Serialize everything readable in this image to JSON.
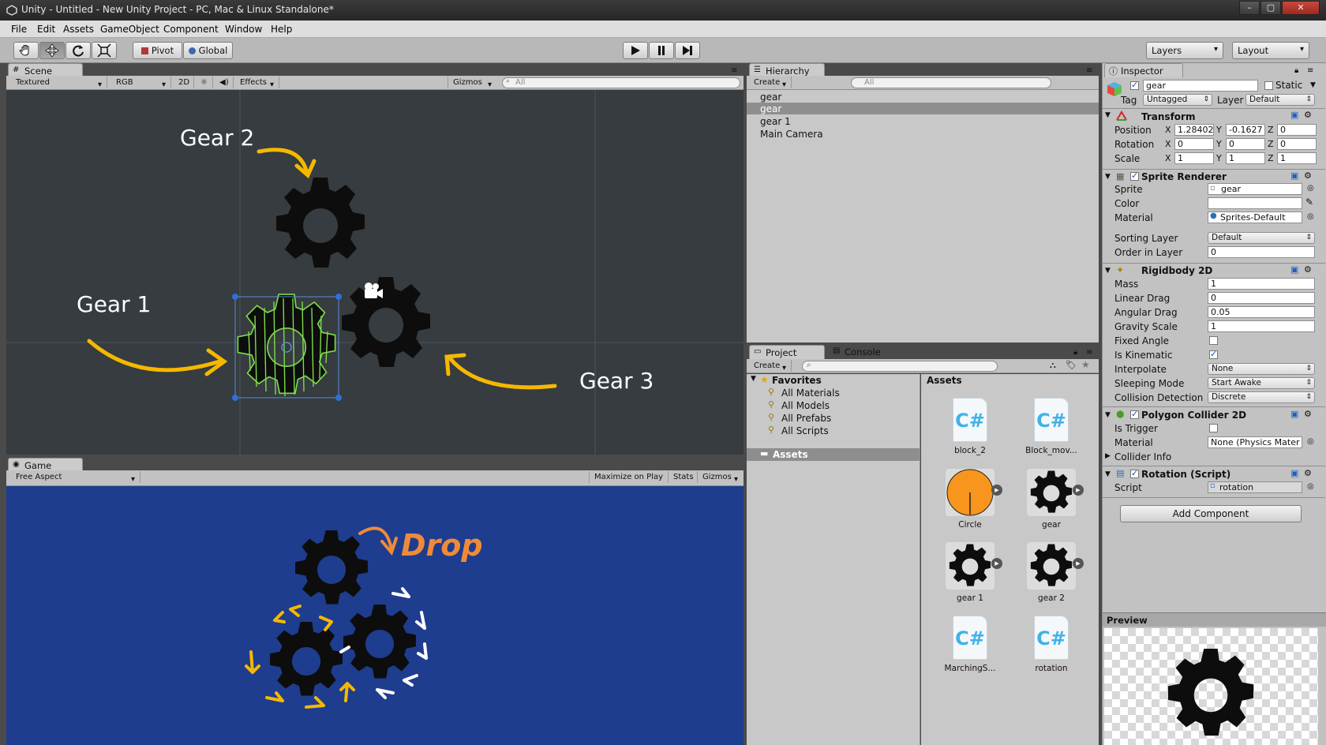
{
  "window": {
    "title": "Unity - Untitled - New Unity Project - PC, Mac & Linux Standalone*",
    "controls": [
      "–",
      "▢",
      "✕"
    ]
  },
  "menu": [
    "File",
    "Edit",
    "Assets",
    "GameObject",
    "Component",
    "Window",
    "Help"
  ],
  "toolbar": {
    "pivot": "Pivot",
    "global": "Global",
    "layers": "Layers",
    "layout": "Layout",
    "tools": [
      "hand-icon",
      "move-icon",
      "rotate-icon",
      "scale-icon"
    ],
    "transport": [
      "play-icon",
      "pause-icon",
      "step-icon"
    ]
  },
  "scene": {
    "tab": "Scene",
    "shading": "Textured",
    "render_mode": "RGB",
    "mode_2d": "2D",
    "effects": "Effects",
    "gizmos": "Gizmos",
    "search_placeholder": "All",
    "annotations": {
      "gear1": "Gear 1",
      "gear2": "Gear 2",
      "gear3": "Gear 3"
    }
  },
  "game": {
    "tab": "Game",
    "aspect": "Free Aspect",
    "maximize": "Maximize on Play",
    "stats": "Stats",
    "gizmos": "Gizmos",
    "drop_label": "Drop"
  },
  "hierarchy": {
    "tab": "Hierarchy",
    "create": "Create",
    "search_placeholder": "All",
    "items": [
      "gear",
      "gear",
      "gear 1",
      "Main Camera"
    ],
    "selected_index": 1
  },
  "project": {
    "tab": "Project",
    "console_tab": "Console",
    "create": "Create",
    "favorites_label": "Favorites",
    "favorites": [
      "All Materials",
      "All Models",
      "All Prefabs",
      "All Scripts"
    ],
    "assets_folder": "Assets",
    "assets_header": "Assets",
    "assets": [
      {
        "name": "block_2",
        "kind": "script"
      },
      {
        "name": "Block_mov...",
        "kind": "script"
      },
      {
        "name": "Circle",
        "kind": "circle"
      },
      {
        "name": "gear",
        "kind": "gear"
      },
      {
        "name": "gear 1",
        "kind": "gear"
      },
      {
        "name": "gear 2",
        "kind": "gear"
      },
      {
        "name": "MarchingS...",
        "kind": "script"
      },
      {
        "name": "rotation",
        "kind": "script"
      }
    ]
  },
  "inspector": {
    "tab": "Inspector",
    "object_name": "gear",
    "static_label": "Static",
    "tag_label": "Tag",
    "tag": "Untagged",
    "layer_label": "Layer",
    "layer": "Default",
    "transform": {
      "title": "Transform",
      "position_label": "Position",
      "rotation_label": "Rotation",
      "scale_label": "Scale",
      "position": [
        "1.28402",
        "-0.1627",
        "0"
      ],
      "rotation": [
        "0",
        "0",
        "0"
      ],
      "scale": [
        "1",
        "1",
        "1"
      ]
    },
    "axes": [
      "X",
      "Y",
      "Z"
    ],
    "sprite_renderer": {
      "title": "Sprite Renderer",
      "sprite_label": "Sprite",
      "sprite": "gear",
      "color_label": "Color",
      "material_label": "Material",
      "material": "Sprites-Default",
      "sorting_layer_label": "Sorting Layer",
      "sorting_layer": "Default",
      "order_label": "Order in Layer",
      "order": "0"
    },
    "rigidbody": {
      "title": "Rigidbody 2D",
      "mass_label": "Mass",
      "mass": "1",
      "linear_drag_label": "Linear Drag",
      "linear_drag": "0",
      "angular_drag_label": "Angular Drag",
      "angular_drag": "0.05",
      "gravity_label": "Gravity Scale",
      "gravity": "1",
      "fixed_angle_label": "Fixed Angle",
      "kinematic_label": "Is Kinematic",
      "interpolate_label": "Interpolate",
      "interpolate": "None",
      "sleeping_label": "Sleeping Mode",
      "sleeping": "Start Awake",
      "collision_label": "Collision Detection",
      "collision": "Discrete"
    },
    "polygon": {
      "title": "Polygon Collider 2D",
      "trigger_label": "Is Trigger",
      "material_label": "Material",
      "material": "None (Physics Mater",
      "collider_info": "Collider Info"
    },
    "rotation_script": {
      "title": "Rotation (Script)",
      "script_label": "Script",
      "script": "rotation"
    },
    "add_component": "Add Component",
    "preview": "Preview"
  },
  "colors": {
    "scene_bg": "#363c3f",
    "game_bg": "#1e3d8e",
    "arrow_yellow": "#f5b800",
    "drop_orange": "#f08a3a",
    "selection_green": "#7ddc4a"
  }
}
